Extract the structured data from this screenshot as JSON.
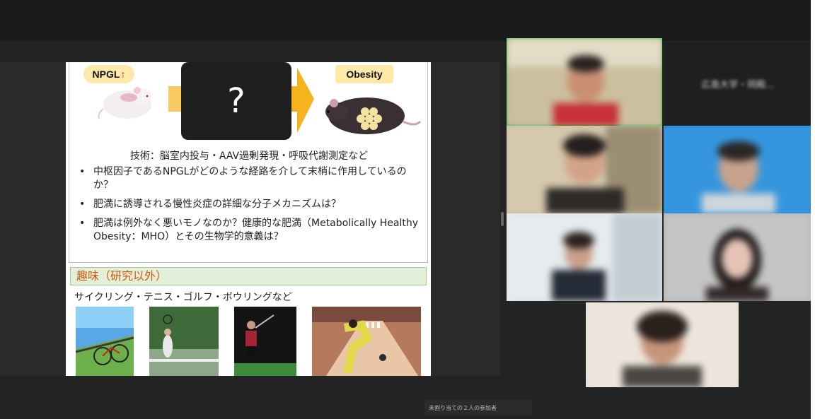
{
  "slide": {
    "npgl_label": "NPGL",
    "npgl_arrow": "↑",
    "question_mark": "?",
    "obesity_label": "Obesity",
    "techniques": "技術：脳室内投与・AAV過剰発現・呼吸代謝測定など",
    "questions": [
      "中枢因子であるNPGLがどのような経路を介して末梢に作用しているのか？",
      "肥満に誘導される慢性炎症の詳細な分子メカニズムは？",
      "肥満は例外なく悪いモノなのか？健康的な肥満（Metabolically Healthy Obesity：MHO）とその生物学的意義は？"
    ],
    "hobby_header": "趣味（研究以外）",
    "hobby_list": "サイクリング・テニス・ゴルフ・ボウリングなど",
    "photos": [
      "cycling-photo",
      "tennis-photo",
      "golf-photo",
      "bowling-photo"
    ]
  },
  "participants": {
    "name_only_label": "広島大学・岡殿...",
    "tiles": [
      {
        "name": "participant-1",
        "active": true
      },
      {
        "name": "participant-2",
        "active": false
      },
      {
        "name": "participant-3",
        "active": false
      },
      {
        "name": "participant-4",
        "active": false
      },
      {
        "name": "participant-5",
        "active": false
      },
      {
        "name": "participant-6",
        "active": false
      }
    ]
  },
  "status": {
    "text": "未割り当ての２人の参加者"
  },
  "colors": {
    "background": "#232323",
    "badge_yellow": "#ffe9a8",
    "hobby_header_bg": "#e2efd9",
    "hobby_header_text": "#d05a12",
    "active_speaker": "#35c54a",
    "arrow_orange": "#f5b41e"
  }
}
